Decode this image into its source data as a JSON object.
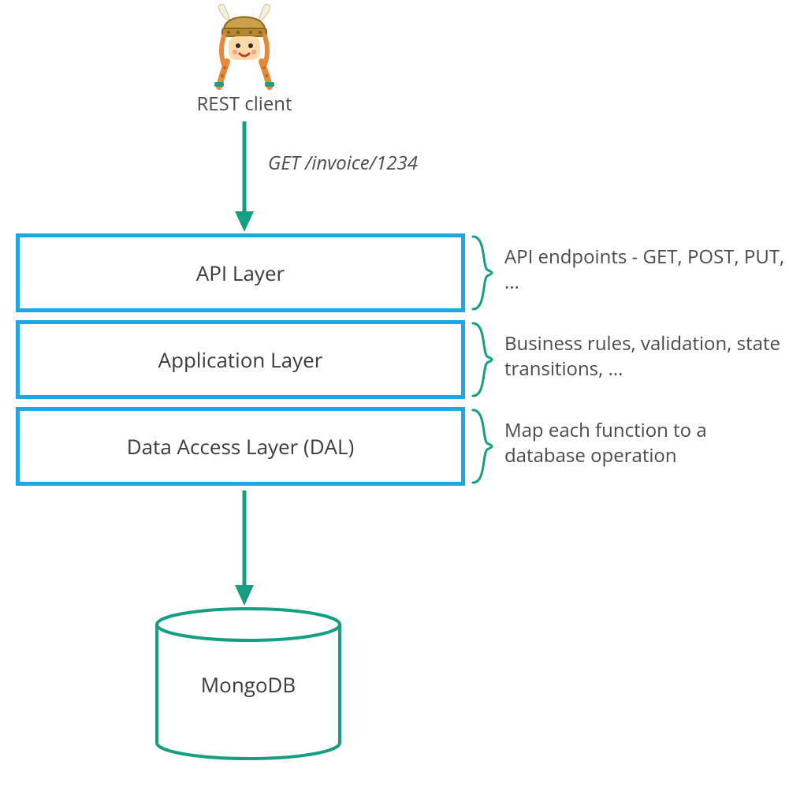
{
  "client": {
    "label": "REST client"
  },
  "request": {
    "label": "GET /invoice/1234"
  },
  "layers": {
    "api": {
      "title": "API Layer",
      "annotation": "API endpoints - GET, POST, PUT, ..."
    },
    "app": {
      "title": "Application Layer",
      "annotation": "Business rules, validation, state transitions, ..."
    },
    "dal": {
      "title": "Data Access Layer (DAL)",
      "annotation": "Map each function to a database operation"
    }
  },
  "database": {
    "label": "MongoDB"
  },
  "colors": {
    "layer_border": "#1ea7e8",
    "accent_green": "#149e82",
    "text": "#444444"
  }
}
